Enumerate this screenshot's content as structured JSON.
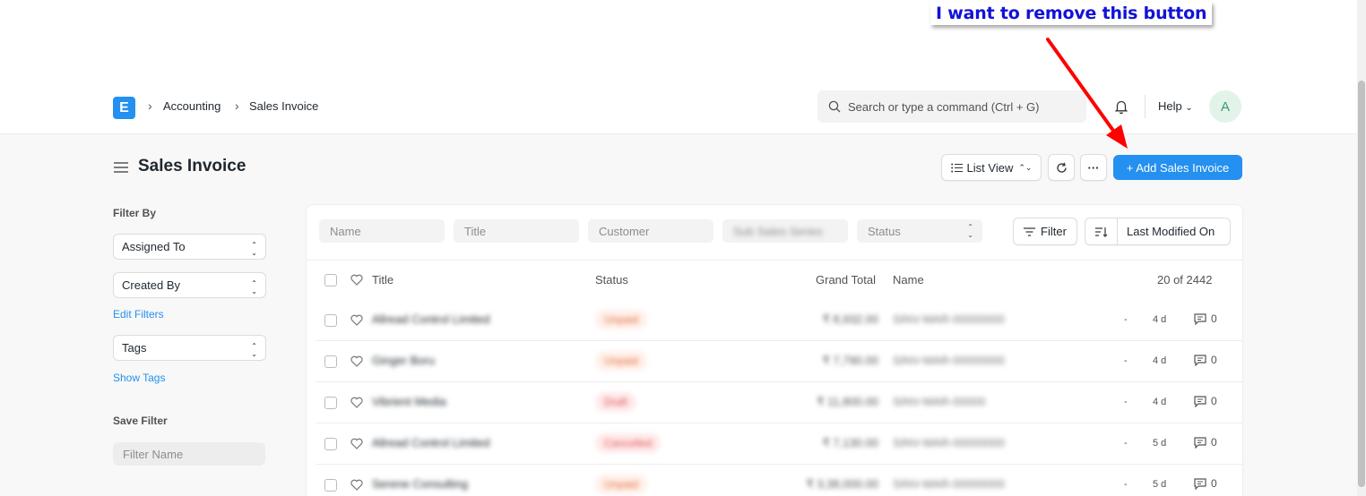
{
  "annotation": {
    "text": "I want to remove this button"
  },
  "navbar": {
    "logo_letter": "E",
    "breadcrumbs": [
      "Accounting",
      "Sales Invoice"
    ],
    "search_placeholder": "Search or type a command (Ctrl + G)",
    "help_label": "Help",
    "avatar_letter": "A"
  },
  "page_head": {
    "title": "Sales Invoice",
    "view_label": "List View",
    "more_label": "···",
    "primary_label": "+ Add Sales Invoice"
  },
  "sidebar": {
    "filter_by": "Filter By",
    "assigned_to": "Assigned To",
    "created_by": "Created By",
    "edit_filters": "Edit Filters",
    "tags": "Tags",
    "show_tags": "Show Tags",
    "save_filter": "Save Filter",
    "filter_name_placeholder": "Filter Name"
  },
  "filters": {
    "name": "Name",
    "title": "Title",
    "customer": "Customer",
    "hidden": "Sub Sales Series",
    "status": "Status",
    "filter_btn": "Filter",
    "sort_label": "Last Modified On"
  },
  "table": {
    "columns": {
      "title": "Title",
      "status": "Status",
      "grand_total": "Grand Total",
      "name": "Name"
    },
    "count": "20 of 2442",
    "rows": [
      {
        "title": "Allread Control Limited",
        "status": "Unpaid",
        "total": "₹ 8,932.00",
        "name": "SINV-MAR-00000000",
        "dash": "-",
        "age": "4 d",
        "comments": "0"
      },
      {
        "title": "Ginger Boru",
        "status": "Unpaid",
        "total": "₹ 7,790.00",
        "name": "SINV-MAR-00000000",
        "dash": "-",
        "age": "4 d",
        "comments": "0"
      },
      {
        "title": "Vibrient Media",
        "status": "Draft",
        "total": "₹ 11,800.00",
        "name": "SINV-MAR-00000",
        "dash": "-",
        "age": "4 d",
        "comments": "0"
      },
      {
        "title": "Allread Control Limited",
        "status": "Cancelled",
        "total": "₹ 7,130.00",
        "name": "SINV-MAR-00000000",
        "dash": "-",
        "age": "5 d",
        "comments": "0"
      },
      {
        "title": "Serene Consulting",
        "status": "Unpaid",
        "total": "₹ 3,38,000.00",
        "name": "SINV-MAR-00000000",
        "dash": "-",
        "age": "5 d",
        "comments": "0"
      }
    ]
  },
  "colors": {
    "primary": "#2490ef",
    "annotation_text": "#1212d8",
    "arrow": "#ff0000"
  }
}
